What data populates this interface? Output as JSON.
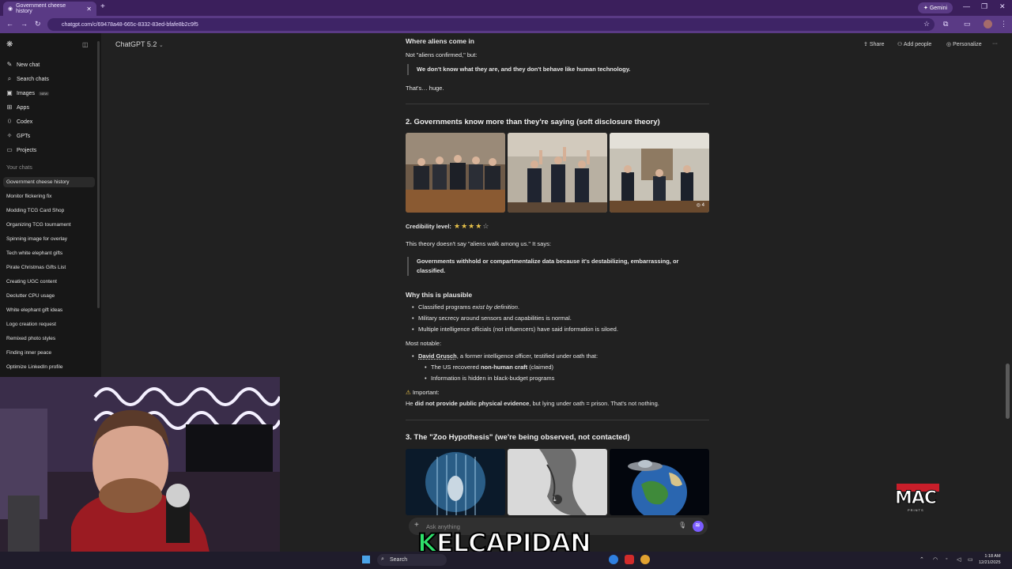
{
  "browser": {
    "tab_title": "Government cheese history",
    "tab_close": "✕",
    "new_tab": "+",
    "gemini_label": "Gemini",
    "url": "chatgpt.com/c/69478a48-665c-8332-83ed-bfafe8b2c9f5",
    "win_min": "—",
    "win_max": "❐",
    "win_close": "✕"
  },
  "sidebar": {
    "items": [
      {
        "label": "New chat",
        "icon": "✎"
      },
      {
        "label": "Search chats",
        "icon": "⌕"
      },
      {
        "label": "Images",
        "icon": "▣",
        "badge": "NEW"
      },
      {
        "label": "Apps",
        "icon": "⊞"
      },
      {
        "label": "Codex",
        "icon": "⟨⟩"
      },
      {
        "label": "GPTs",
        "icon": "✧"
      },
      {
        "label": "Projects",
        "icon": "▭"
      }
    ],
    "chats_heading": "Your chats",
    "chats": [
      "Government cheese history",
      "Monitor flickering fix",
      "Modding TCG Card Shop",
      "Organizing TCG tournament",
      "Spinning image for overlay",
      "Tech white elephant gifts",
      "Pirate Christmas Gifts List",
      "Creating UGC content",
      "Declutter CPU usage",
      "White elephant gift ideas",
      "Logo creation request",
      "Remixed photo styles",
      "Finding inner peace",
      "Optimize LinkedIn profile"
    ]
  },
  "header": {
    "model": "ChatGPT 5.2",
    "share": "Share",
    "add_people": "Add people",
    "personalize": "Personalize",
    "more": "···"
  },
  "content": {
    "aliens_heading": "Where aliens come in",
    "not_aliens": "Not \"aliens confirmed,\" but:",
    "quote1": "We don't know what they are, and they don't behave like human technology.",
    "huge": "That's… huge.",
    "section2_title": "2. Governments know more than they're saying (soft disclosure theory)",
    "image_badge": "4",
    "credibility_label": "Credibility level:",
    "credibility_rating": 4,
    "credibility_max": 5,
    "theory_intro": "This theory doesn't say \"aliens walk among us.\" It says:",
    "quote2": "Governments withhold or compartmentalize data because it's destabilizing, embarrassing, or classified.",
    "why_heading": "Why this is plausible",
    "bullet1_pre": "Classified programs ",
    "bullet1_em": "exist by definition",
    "bullet1_post": ".",
    "bullet2": "Military secrecy around sensors and capabilities is normal.",
    "bullet3": "Multiple intelligence officials (not influencers) have said information is siloed.",
    "notable": "Most notable:",
    "grusch_name": "David Grusch",
    "grusch_rest": ", a former intelligence officer, testified under oath that:",
    "sub1_pre": "The US recovered ",
    "sub1_bold": "non-human craft",
    "sub1_post": " (claimed)",
    "sub2": "Information is hidden in black-budget programs",
    "important_label": "Important:",
    "important_pre": "He ",
    "important_bold": "did not provide public physical evidence",
    "important_post": ", but lying under oath = prison. That's not nothing.",
    "section3_title": "3. The \"Zoo Hypothesis\" (we're being observed, not contacted)"
  },
  "composer": {
    "placeholder": "Ask anything",
    "plus": "+"
  },
  "overlay": {
    "name_k": "K",
    "name_rest": "ELCAPIDAN",
    "logo_text": "MAC",
    "logo_sub": "PRINTS"
  },
  "taskbar": {
    "search": "Search",
    "time": "1:18 AM",
    "date": "12/21/2025"
  }
}
